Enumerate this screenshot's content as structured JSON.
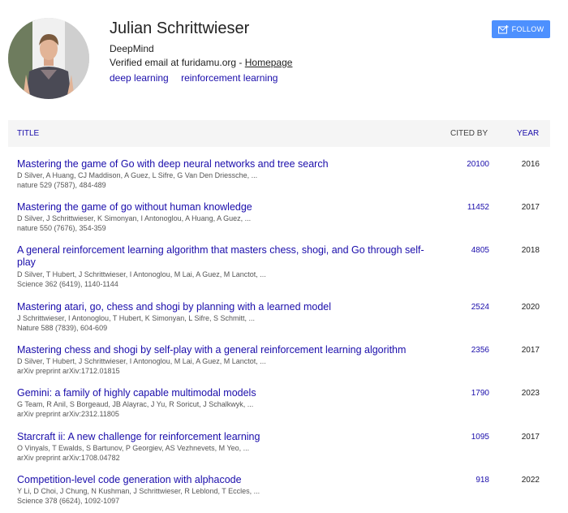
{
  "profile": {
    "name": "Julian Schrittwieser",
    "affiliation": "DeepMind",
    "email_prefix": "Verified email at furidamu.org - ",
    "homepage_label": "Homepage",
    "interests": [
      "deep learning",
      "reinforcement learning"
    ],
    "follow_label": "FOLLOW"
  },
  "table": {
    "headers": {
      "title": "TITLE",
      "cited_by": "CITED BY",
      "year": "YEAR"
    },
    "rows": [
      {
        "title": "Mastering the game of Go with deep neural networks and tree search",
        "authors": "D Silver, A Huang, CJ Maddison, A Guez, L Sifre, G Van Den Driessche, ...",
        "venue": "nature 529 (7587), 484-489",
        "cited": "20100",
        "year": "2016"
      },
      {
        "title": "Mastering the game of go without human knowledge",
        "authors": "D Silver, J Schrittwieser, K Simonyan, I Antonoglou, A Huang, A Guez, ...",
        "venue": "nature 550 (7676), 354-359",
        "cited": "11452",
        "year": "2017"
      },
      {
        "title": "A general reinforcement learning algorithm that masters chess, shogi, and Go through self-play",
        "authors": "D Silver, T Hubert, J Schrittwieser, I Antonoglou, M Lai, A Guez, M Lanctot, ...",
        "venue": "Science 362 (6419), 1140-1144",
        "cited": "4805",
        "year": "2018"
      },
      {
        "title": "Mastering atari, go, chess and shogi by planning with a learned model",
        "authors": "J Schrittwieser, I Antonoglou, T Hubert, K Simonyan, L Sifre, S Schmitt, ...",
        "venue": "Nature 588 (7839), 604-609",
        "cited": "2524",
        "year": "2020"
      },
      {
        "title": "Mastering chess and shogi by self-play with a general reinforcement learning algorithm",
        "authors": "D Silver, T Hubert, J Schrittwieser, I Antonoglou, M Lai, A Guez, M Lanctot, ...",
        "venue": "arXiv preprint arXiv:1712.01815",
        "cited": "2356",
        "year": "2017"
      },
      {
        "title": "Gemini: a family of highly capable multimodal models",
        "authors": "G Team, R Anil, S Borgeaud, JB Alayrac, J Yu, R Soricut, J Schalkwyk, ...",
        "venue": "arXiv preprint arXiv:2312.11805",
        "cited": "1790",
        "year": "2023"
      },
      {
        "title": "Starcraft ii: A new challenge for reinforcement learning",
        "authors": "O Vinyals, T Ewalds, S Bartunov, P Georgiev, AS Vezhnevets, M Yeo, ...",
        "venue": "arXiv preprint arXiv:1708.04782",
        "cited": "1095",
        "year": "2017"
      },
      {
        "title": "Competition-level code generation with alphacode",
        "authors": "Y Li, D Choi, J Chung, N Kushman, J Schrittwieser, R Leblond, T Eccles, ...",
        "venue": "Science 378 (6624), 1092-1097",
        "cited": "918",
        "year": "2022"
      }
    ]
  },
  "icons": {
    "follow": "envelope-plus-icon",
    "avatar": "profile-photo"
  },
  "colors": {
    "link": "#1a0dab",
    "follow_button": "#4d90fe",
    "header_bg": "#f5f5f5"
  }
}
